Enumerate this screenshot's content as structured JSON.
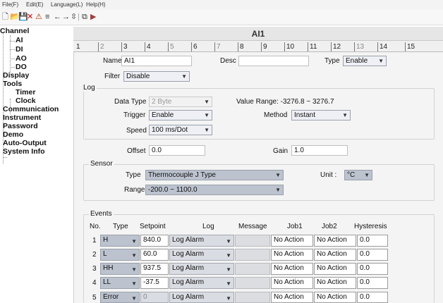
{
  "menu": {
    "file": "File(F)",
    "edit": "Edit(E)",
    "language": "Language(L)",
    "help": "Help(H)"
  },
  "toolbar": {
    "new": "🗋",
    "open": "📂",
    "save": "💾",
    "close": "✕",
    "warn": "⚠",
    "align": "≡",
    "prev": "←",
    "next": "→",
    "grid": "⇳",
    "sep": "|",
    "copy": "⧉",
    "paste": "▶"
  },
  "tree": {
    "channel": "Channel",
    "ai": "AI",
    "di": "DI",
    "ao": "AO",
    "do": "DO",
    "display": "Display",
    "tools": "Tools",
    "timer": "Timer",
    "clock": "Clock",
    "communication": "Communication",
    "instrument": "Instrument",
    "password": "Password",
    "demo": "Demo",
    "auto_output": "Auto-Output",
    "system_info": "System Info"
  },
  "panel_title": "AI1",
  "tabs": [
    "1",
    "2",
    "3",
    "4",
    "5",
    "6",
    "7",
    "8",
    "9",
    "10",
    "11",
    "12",
    "13",
    "14",
    "15"
  ],
  "form": {
    "name_label": "Name",
    "name_value": "AI1",
    "desc_label": "Desc",
    "desc_value": "",
    "type_label": "Type",
    "type_value": "Enable",
    "filter_label": "Filter",
    "filter_value": "Disable",
    "log_group": "Log",
    "data_type_label": "Data Type",
    "data_type_value": "2 Byte",
    "value_range_label": "Value Range: -3276.8 ~ 3276.7",
    "trigger_label": "Trigger",
    "trigger_value": "Enable",
    "method_label": "Method",
    "method_value": "Instant",
    "speed_label": "Speed",
    "speed_value": "100 ms/Dot",
    "offset_label": "Offset",
    "offset_value": "0.0",
    "gain_label": "Gain",
    "gain_value": "1.0",
    "sensor_group": "Sensor",
    "sensor_type_label": "Type",
    "sensor_type_value": "Thermocouple J Type",
    "unit_label": "Unit :",
    "unit_value": "°C",
    "range_label": "Range",
    "range_value": "-200.0 ~ 1100.0"
  },
  "events": {
    "group": "Events",
    "headers": {
      "no": "No.",
      "type": "Type",
      "setpoint": "Setpoint",
      "log": "Log",
      "message": "Message",
      "job1": "Job1",
      "job2": "Job2",
      "hysteresis": "Hysteresis"
    },
    "rows": [
      {
        "no": "1",
        "type": "H",
        "setpoint": "840.0",
        "log": "Log Alarm",
        "job1": "No Action",
        "job2": "No Action",
        "hys": "0.0"
      },
      {
        "no": "2",
        "type": "L",
        "setpoint": "60.0",
        "log": "Log Alarm",
        "job1": "No Action",
        "job2": "No Action",
        "hys": "0.0"
      },
      {
        "no": "3",
        "type": "HH",
        "setpoint": "937.5",
        "log": "Log Alarm",
        "job1": "No Action",
        "job2": "No Action",
        "hys": "0.0"
      },
      {
        "no": "4",
        "type": "LL",
        "setpoint": "-37.5",
        "log": "Log Alarm",
        "job1": "No Action",
        "job2": "No Action",
        "hys": "0.0"
      },
      {
        "no": "5",
        "type": "Error",
        "setpoint": "0",
        "log": "Log Alarm",
        "job1": "No Action",
        "job2": "No Action",
        "hys": "0.0"
      }
    ]
  }
}
